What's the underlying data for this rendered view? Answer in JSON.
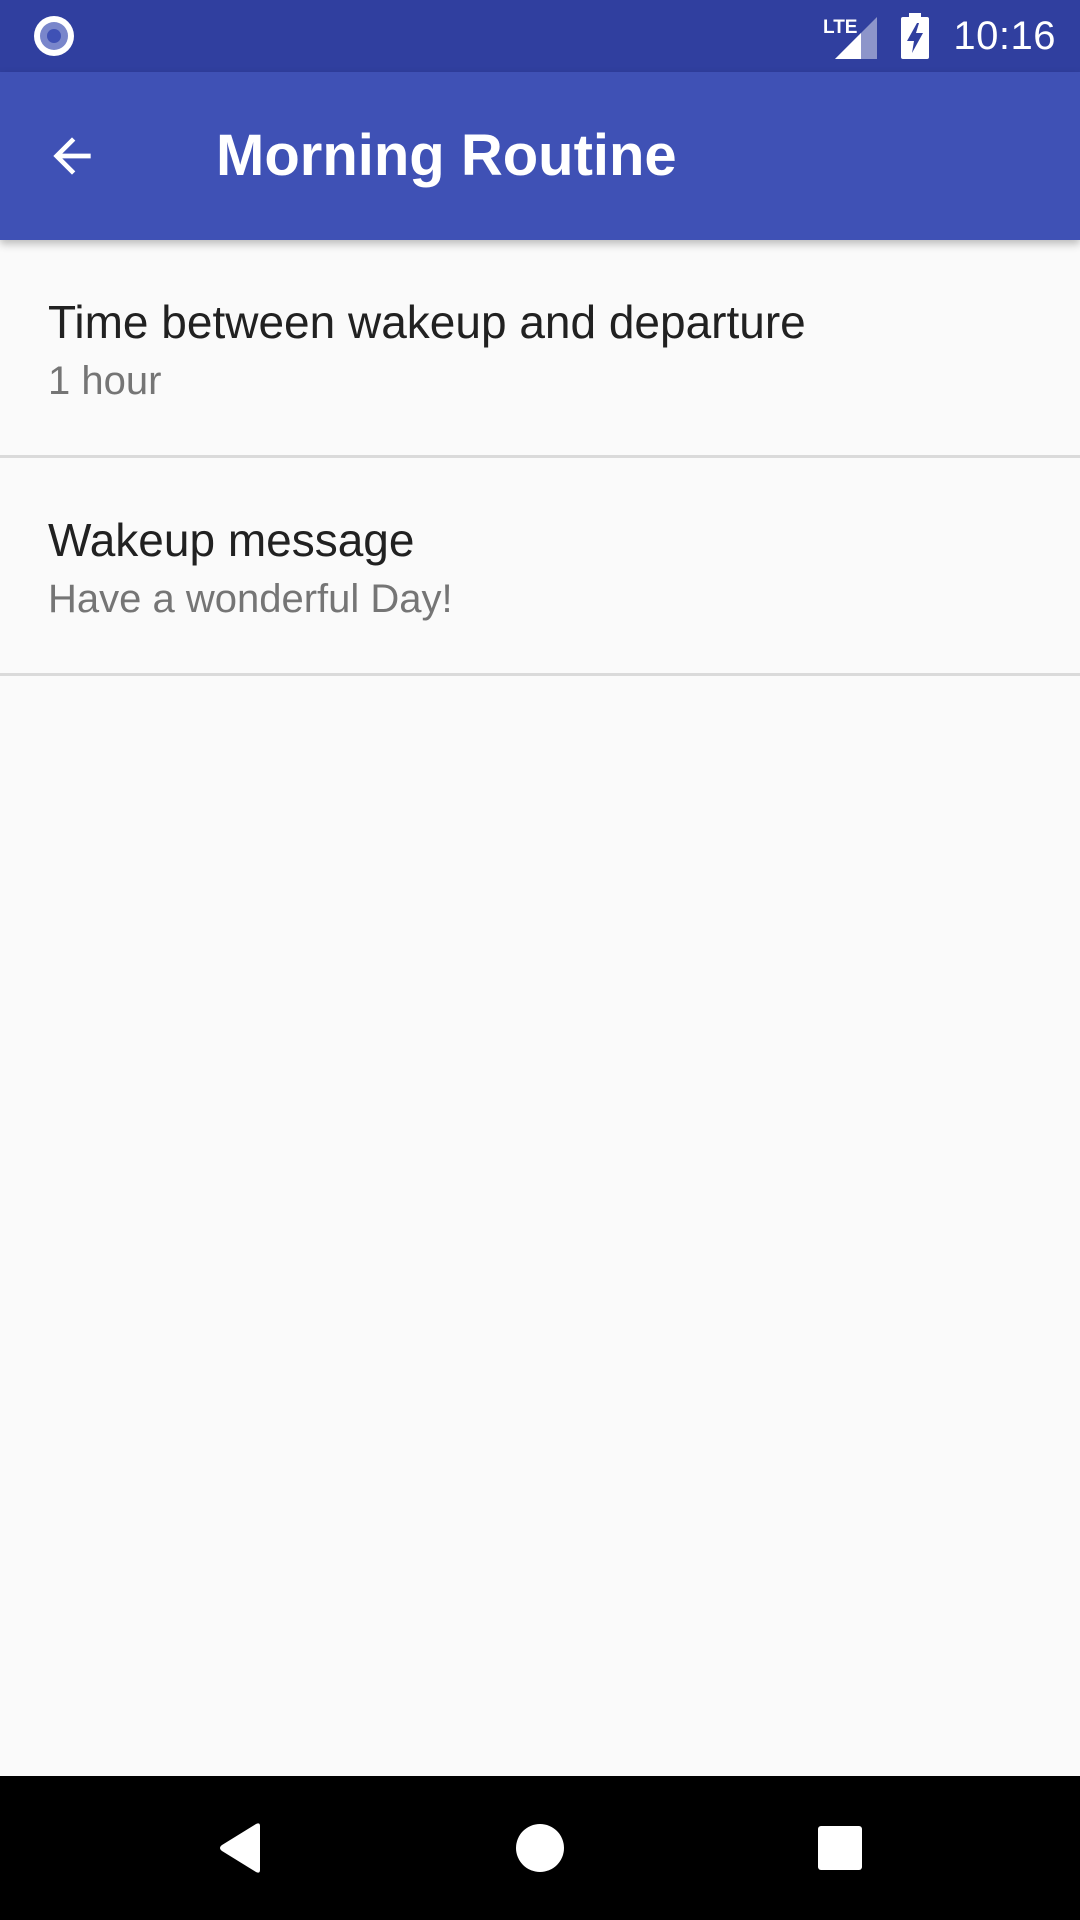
{
  "status_bar": {
    "time": "10:16",
    "network": "LTE",
    "icons": [
      "notification-circle-icon",
      "lte-signal-icon",
      "battery-charging-icon"
    ],
    "color": "#303f9f"
  },
  "app_bar": {
    "title": "Morning Routine",
    "back_icon": "arrow-back-icon",
    "color": "#3f51b5"
  },
  "preferences": [
    {
      "title": "Time between wakeup and departure",
      "summary": "1 hour"
    },
    {
      "title": "Wakeup message",
      "summary": "Have a wonderful Day!"
    }
  ],
  "nav_bar": {
    "icons": [
      "nav-back-icon",
      "nav-home-icon",
      "nav-recents-icon"
    ]
  }
}
